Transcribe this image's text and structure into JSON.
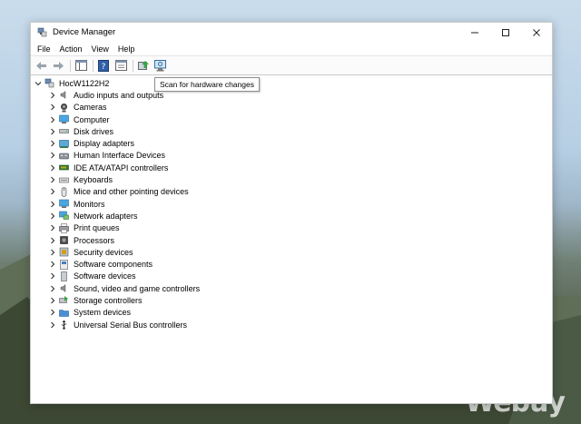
{
  "window": {
    "title": "Device Manager"
  },
  "menu": [
    "File",
    "Action",
    "View",
    "Help"
  ],
  "tooltip": "Scan for hardware changes",
  "tree": {
    "root": "HocW1122H2",
    "categories": [
      {
        "label": "Audio inputs and outputs",
        "icon": "speaker-icon"
      },
      {
        "label": "Cameras",
        "icon": "camera-icon"
      },
      {
        "label": "Computer",
        "icon": "monitor-icon"
      },
      {
        "label": "Disk drives",
        "icon": "disk-drive-icon"
      },
      {
        "label": "Display adapters",
        "icon": "display-adapter-icon"
      },
      {
        "label": "Human Interface Devices",
        "icon": "hid-icon"
      },
      {
        "label": "IDE ATA/ATAPI controllers",
        "icon": "ide-controller-icon"
      },
      {
        "label": "Keyboards",
        "icon": "keyboard-icon"
      },
      {
        "label": "Mice and other pointing devices",
        "icon": "mouse-icon"
      },
      {
        "label": "Monitors",
        "icon": "monitor-icon"
      },
      {
        "label": "Network adapters",
        "icon": "network-icon"
      },
      {
        "label": "Print queues",
        "icon": "printer-icon"
      },
      {
        "label": "Processors",
        "icon": "processor-icon"
      },
      {
        "label": "Security devices",
        "icon": "security-icon"
      },
      {
        "label": "Software components",
        "icon": "software-component-icon"
      },
      {
        "label": "Software devices",
        "icon": "software-device-icon"
      },
      {
        "label": "Sound, video and game controllers",
        "icon": "speaker-icon"
      },
      {
        "label": "Storage controllers",
        "icon": "storage-icon"
      },
      {
        "label": "System devices",
        "icon": "system-folder-icon"
      },
      {
        "label": "Universal Serial Bus controllers",
        "icon": "usb-icon"
      }
    ]
  },
  "watermark": "Webuy"
}
